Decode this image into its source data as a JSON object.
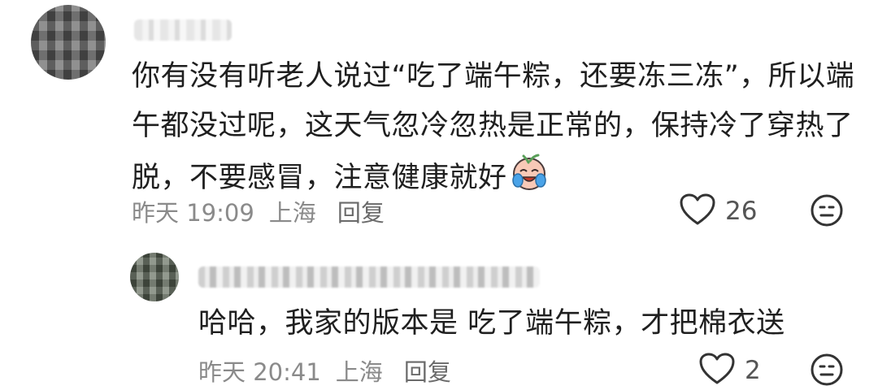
{
  "comments": [
    {
      "text": "你有没有听老人说过“吃了端午粽，还要冻三冻”，所以端午都没过呢，这天气忽冷忽热是正常的，保持冷了穿热了脱，不要感冒，注意健康就好",
      "text_lines": [
        "你有没有听老人说过“吃了端午粽，还要冻三冻”，所以端",
        "午都没过呢，这天气忽冷忽热是正常的，保持冷了穿热了",
        "脱，不要感冒，注意健康就好"
      ],
      "sticker_icon": "crying-laughing-face-icon",
      "time": "昨天 19:09",
      "location": "上海",
      "reply_label": "回复",
      "likes": "26"
    },
    {
      "text": "哈哈，我家的版本是 吃了端午粽，才把棉衣送",
      "time": "昨天 20:41",
      "location": "上海",
      "reply_label": "回复",
      "likes": "2"
    }
  ],
  "icons": {
    "like": "heart-outline-icon",
    "dislike": "neutral-face-icon"
  }
}
